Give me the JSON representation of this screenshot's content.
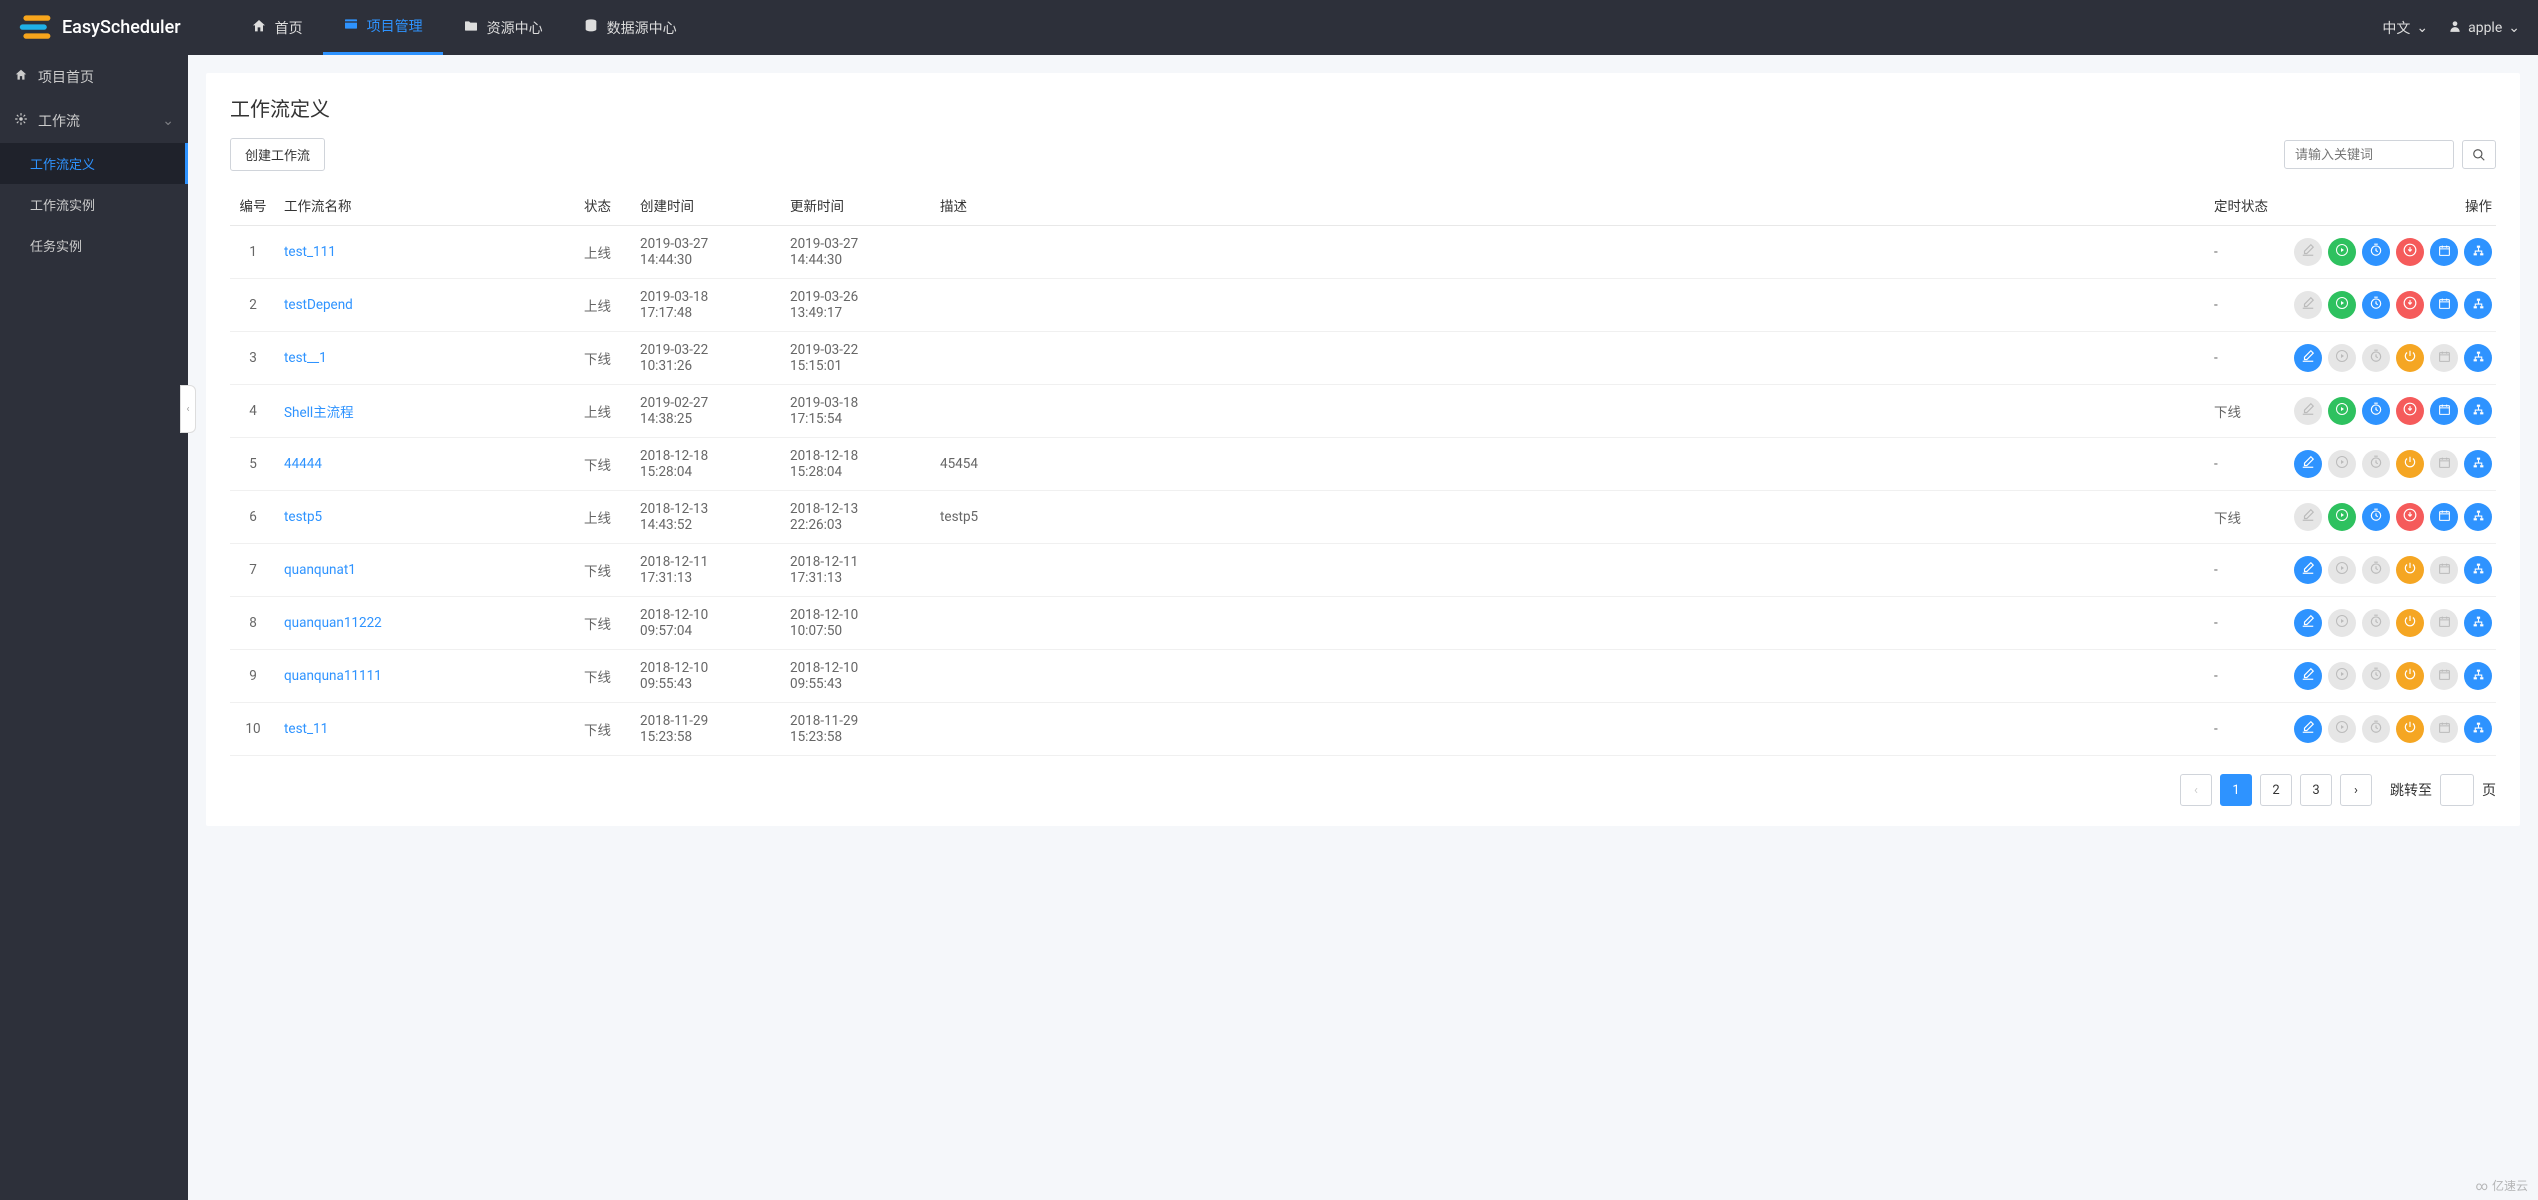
{
  "brand": "EasyScheduler",
  "topnav": {
    "items": [
      {
        "label": "首页",
        "icon": "home"
      },
      {
        "label": "项目管理",
        "icon": "project",
        "active": true
      },
      {
        "label": "资源中心",
        "icon": "folder"
      },
      {
        "label": "数据源中心",
        "icon": "database"
      }
    ],
    "language": "中文",
    "user": "apple"
  },
  "sidebar": {
    "home": "项目首页",
    "workflow": "工作流",
    "subs": [
      {
        "label": "工作流定义",
        "active": true
      },
      {
        "label": "工作流实例"
      },
      {
        "label": "任务实例"
      }
    ]
  },
  "page": {
    "title": "工作流定义",
    "create_btn": "创建工作流",
    "search_placeholder": "请输入关键词"
  },
  "table": {
    "headers": {
      "index": "编号",
      "name": "工作流名称",
      "state": "状态",
      "create_time": "创建时间",
      "update_time": "更新时间",
      "desc": "描述",
      "cron_state": "定时状态",
      "operation": "操作"
    },
    "rows": [
      {
        "idx": "1",
        "name": "test_111",
        "state": "上线",
        "create": "2019-03-27 14:44:30",
        "update": "2019-03-27 14:44:30",
        "desc": "",
        "cron": "-",
        "mode": "online"
      },
      {
        "idx": "2",
        "name": "testDepend",
        "state": "上线",
        "create": "2019-03-18 17:17:48",
        "update": "2019-03-26 13:49:17",
        "desc": "",
        "cron": "-",
        "mode": "online"
      },
      {
        "idx": "3",
        "name": "test__1",
        "state": "下线",
        "create": "2019-03-22 10:31:26",
        "update": "2019-03-22 15:15:01",
        "desc": "",
        "cron": "-",
        "mode": "offline"
      },
      {
        "idx": "4",
        "name": "Shell主流程",
        "state": "上线",
        "create": "2019-02-27 14:38:25",
        "update": "2019-03-18 17:15:54",
        "desc": "",
        "cron": "下线",
        "mode": "online"
      },
      {
        "idx": "5",
        "name": "44444",
        "state": "下线",
        "create": "2018-12-18 15:28:04",
        "update": "2018-12-18 15:28:04",
        "desc": "45454",
        "cron": "-",
        "mode": "offline"
      },
      {
        "idx": "6",
        "name": "testp5",
        "state": "上线",
        "create": "2018-12-13 14:43:52",
        "update": "2018-12-13 22:26:03",
        "desc": "testp5",
        "cron": "下线",
        "mode": "online"
      },
      {
        "idx": "7",
        "name": "quanqunat1",
        "state": "下线",
        "create": "2018-12-11 17:31:13",
        "update": "2018-12-11 17:31:13",
        "desc": "",
        "cron": "-",
        "mode": "offline"
      },
      {
        "idx": "8",
        "name": "quanquan11222",
        "state": "下线",
        "create": "2018-12-10 09:57:04",
        "update": "2018-12-10 10:07:50",
        "desc": "",
        "cron": "-",
        "mode": "offline"
      },
      {
        "idx": "9",
        "name": "quanquna11111",
        "state": "下线",
        "create": "2018-12-10 09:55:43",
        "update": "2018-12-10 09:55:43",
        "desc": "",
        "cron": "-",
        "mode": "offline"
      },
      {
        "idx": "10",
        "name": "test_11",
        "state": "下线",
        "create": "2018-11-29 15:23:58",
        "update": "2018-11-29 15:23:58",
        "desc": "",
        "cron": "-",
        "mode": "offline"
      }
    ]
  },
  "pagination": {
    "pages": [
      "1",
      "2",
      "3"
    ],
    "current": "1",
    "jump_label": "跳转至",
    "page_suffix": "页"
  },
  "watermark": "亿速云"
}
